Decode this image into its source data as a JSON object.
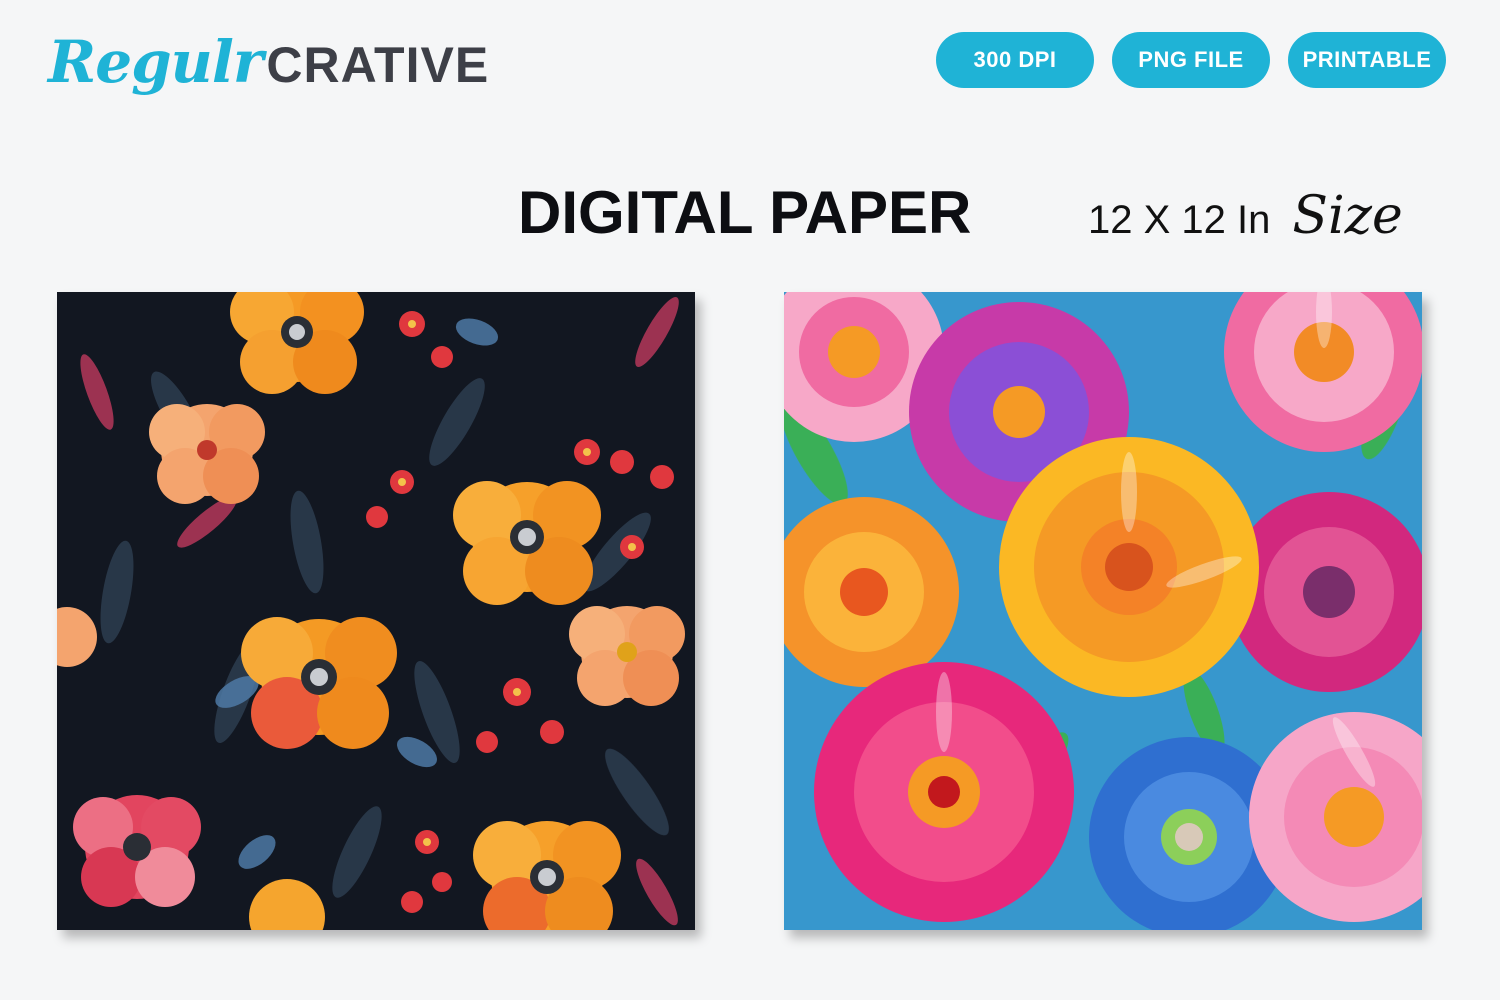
{
  "brand": {
    "script": "Regulr",
    "word": "CRATIVE"
  },
  "badges": [
    "300 DPI",
    "PNG FILE",
    "PRINTABLE"
  ],
  "title": "DIGITAL PAPER",
  "size": {
    "text": "12 X 12 In",
    "script": "Size"
  },
  "colors": {
    "accent": "#1fb3d6",
    "dark_bg": "#121721"
  }
}
